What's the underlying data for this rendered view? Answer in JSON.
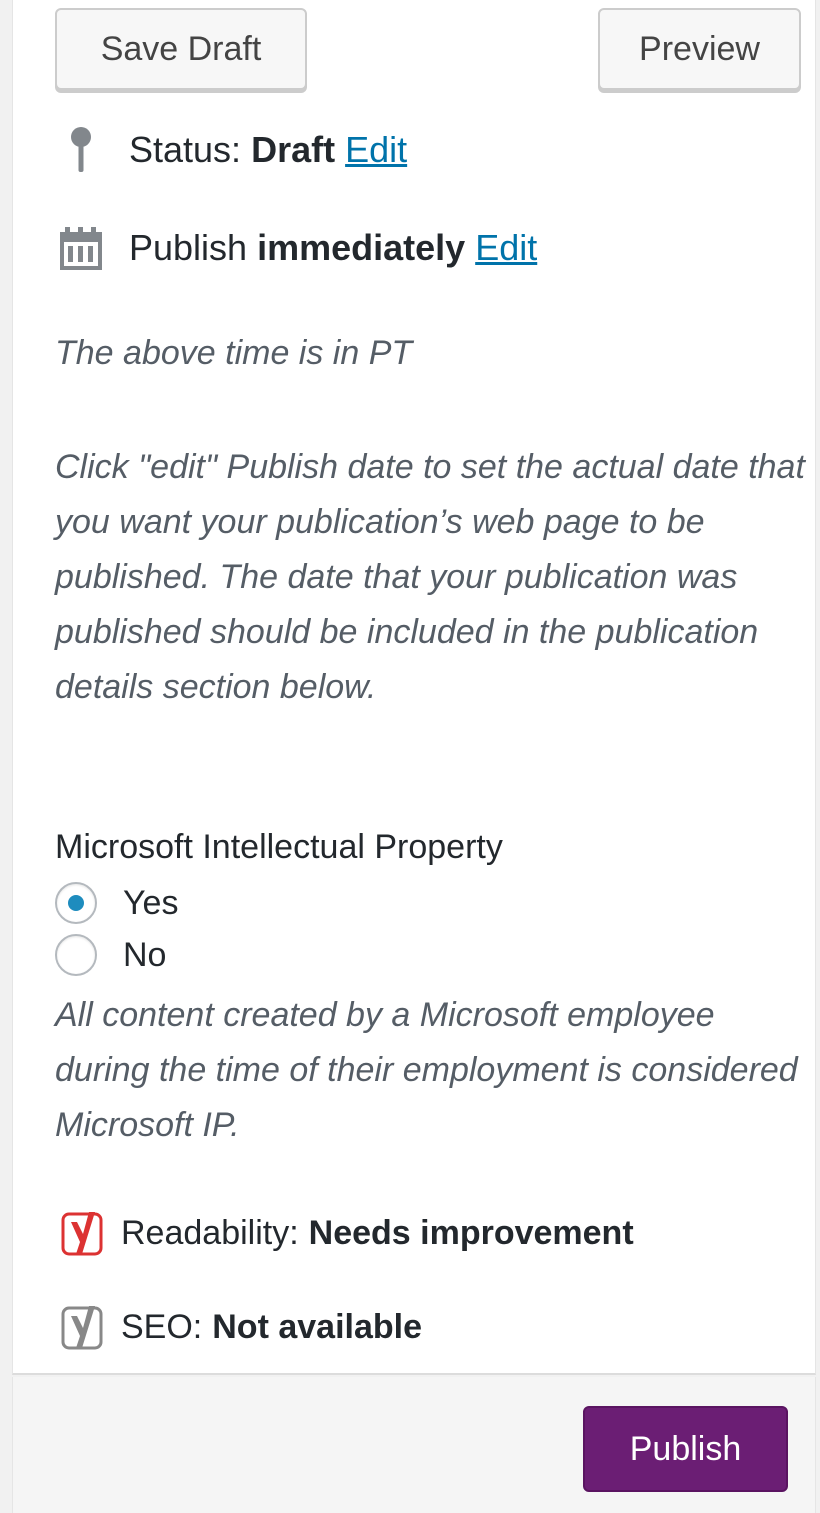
{
  "buttons": {
    "save_draft": "Save Draft",
    "preview": "Preview",
    "publish": "Publish"
  },
  "status": {
    "label": "Status:",
    "value": "Draft",
    "edit": "Edit",
    "icon": "pin-icon"
  },
  "schedule": {
    "label": "Publish",
    "value": "immediately",
    "edit": "Edit",
    "icon": "calendar-icon"
  },
  "timezone_note": "The above time is in PT",
  "help_note": "Click \"edit\" Publish date to set the actual date that you want your publication’s web page to be published. The date that your publication was published should be included in the publication details section below.",
  "ip": {
    "label": "Microsoft Intellectual Property",
    "options": [
      {
        "label": "Yes",
        "checked": true
      },
      {
        "label": "No",
        "checked": false
      }
    ],
    "note": "All content created by a Microsoft employee during the time of their employment is considered Microsoft IP."
  },
  "yoast": {
    "readability_label": "Readability:",
    "readability_value": "Needs improvement",
    "seo_label": "SEO:",
    "seo_value": "Not available"
  },
  "colors": {
    "link": "#0073aa",
    "publish_button": "#6b1e74",
    "radio_checked": "#1e8cbe",
    "readability_bad": "#dc3232",
    "seo_na": "#888888"
  }
}
